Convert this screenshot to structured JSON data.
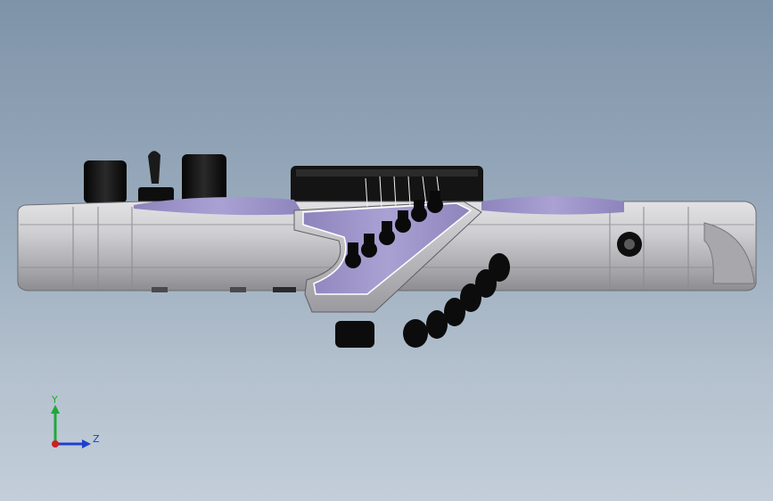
{
  "viewport": {
    "background_top": "#7f93a8",
    "background_bottom": "#c3ced9"
  },
  "model": {
    "description_icon": "guitar-body-3d-model-icon",
    "body_color": "#c9c9cc",
    "top_color": "#9d93c8",
    "hardware_color": "#111111"
  },
  "triad": {
    "y_label": "Y",
    "z_label": "Z",
    "y_color": "#1fa83a",
    "z_color": "#1f3ecf",
    "x_color": "#cc1f1f"
  }
}
